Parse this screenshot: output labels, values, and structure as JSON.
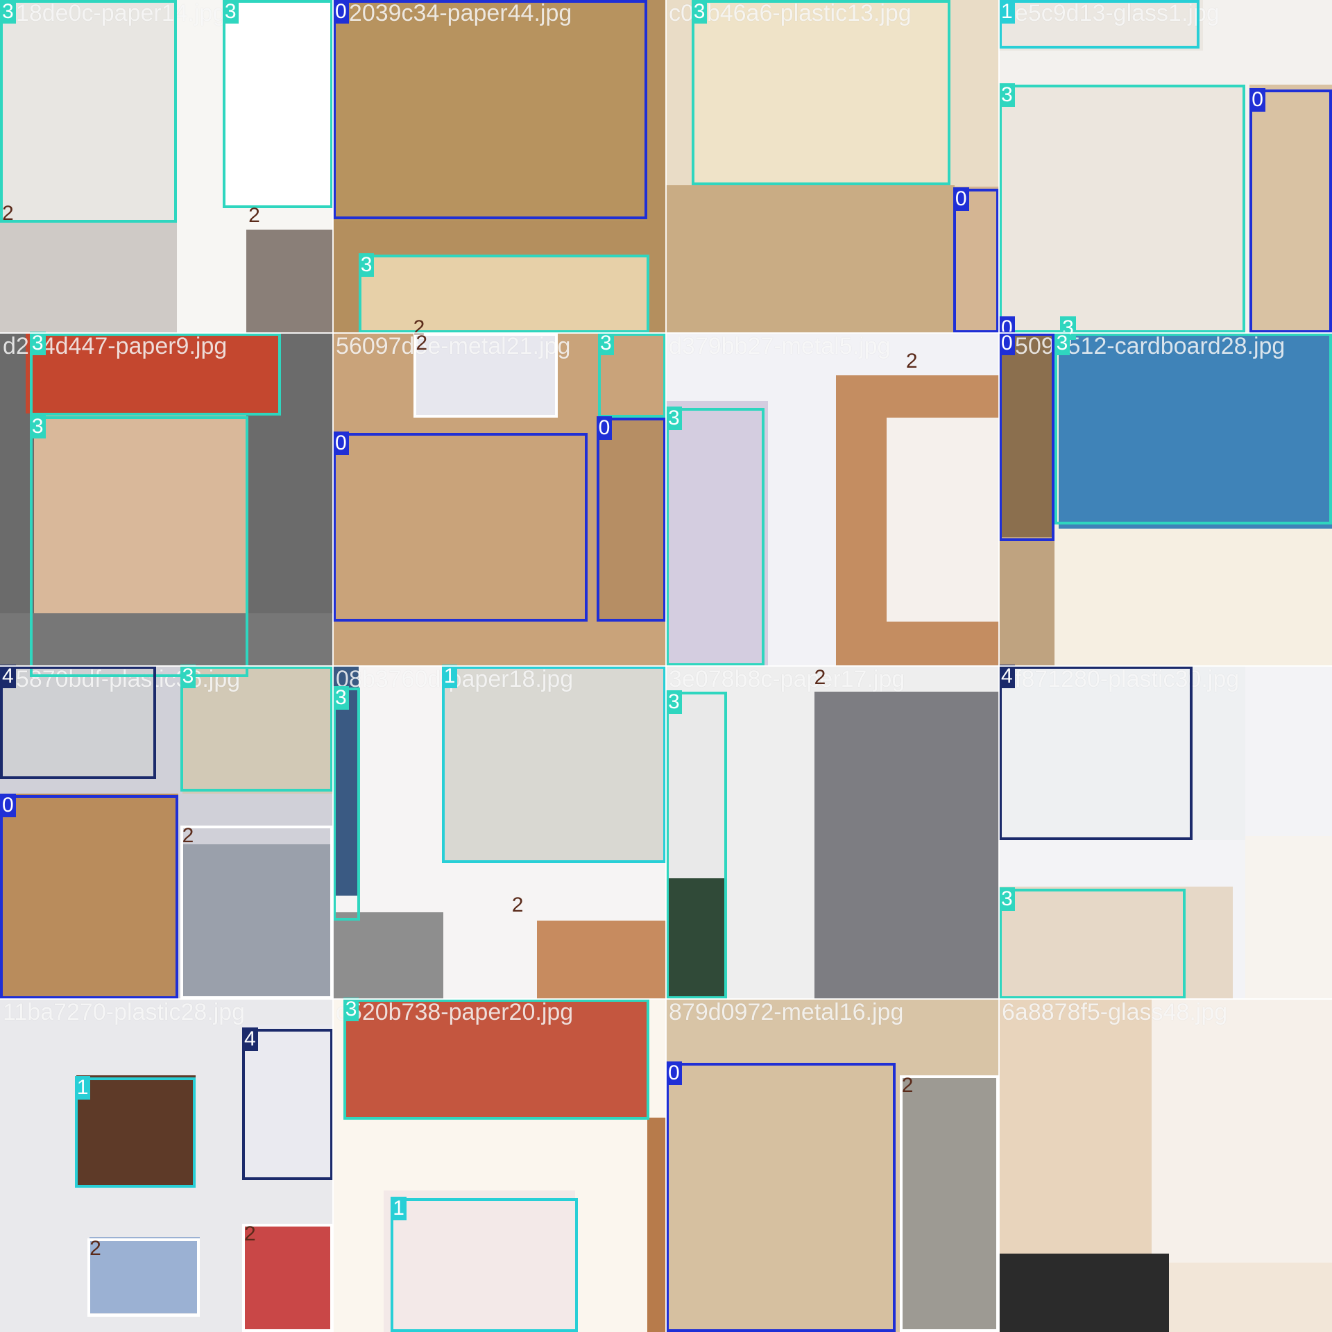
{
  "class_colors": {
    "0": "#1f2fd6",
    "1": "#28cfd6",
    "2": "#ffffff",
    "3": "#2fd6bf",
    "4": "#1b2a6b"
  },
  "label_text_colors": {
    "0": "#ffffff",
    "1": "#ffffff",
    "2": "#5a2a1a",
    "3": "#ffffff",
    "4": "#ffffff"
  },
  "tiles": [
    {
      "filename": "318de0c-paper14.jpg",
      "bg": "#f7f6f3"
    },
    {
      "filename": "12039c34-paper44.jpg",
      "bg": "#b48f5e"
    },
    {
      "filename": "c03b46a6-plastic13.jpg",
      "bg": "#e9dcc6"
    },
    {
      "filename": "1e5c9d13-glass1.jpg",
      "bg": "#f3f1ee"
    },
    {
      "filename": "d2d4d447-paper9.jpg",
      "bg": "#6b6b6b"
    },
    {
      "filename": "56097d5e-metal21.jpg",
      "bg": "#c9a37a"
    },
    {
      "filename": "d379bb27-metal5.jpg",
      "bg": "#f2f2f6"
    },
    {
      "filename": "a5092512-cardboard28.jpg",
      "bg": "#f6efe2"
    },
    {
      "filename": "05870bdf-plastic36.jpg",
      "bg": "#d0d0d8"
    },
    {
      "filename": "08b3760d-paper18.jpg",
      "bg": "#f6f4f4"
    },
    {
      "filename": "3e078b8c-paper17.jpg",
      "bg": "#eeeeee"
    },
    {
      "filename": "3f871280-plastic30.jpg",
      "bg": "#f3f3f6"
    },
    {
      "filename": "11ba7270-plastic28.jpg",
      "bg": "#e9e9ec"
    },
    {
      "filename": "d520b738-paper20.jpg",
      "bg": "#fbf6ee"
    },
    {
      "filename": "879d0972-metal16.jpg",
      "bg": "#d8c4a6"
    },
    {
      "filename": "6a8878f5-glass48.jpg",
      "bg": "#f2e6d8"
    }
  ],
  "boxes": [
    {
      "cls": "3"
    },
    {
      "cls": "3"
    },
    {
      "cls": "2"
    },
    {
      "cls": "2"
    },
    {
      "cls": "0"
    },
    {
      "cls": "3"
    },
    {
      "cls": "2"
    },
    {
      "cls": "3"
    },
    {
      "cls": "0"
    },
    {
      "cls": "1"
    },
    {
      "cls": "3"
    },
    {
      "cls": "0"
    },
    {
      "cls": "0"
    },
    {
      "cls": "3"
    },
    {
      "cls": "3"
    },
    {
      "cls": "3"
    },
    {
      "cls": "0"
    },
    {
      "cls": "0"
    },
    {
      "cls": "3"
    },
    {
      "cls": "2"
    },
    {
      "cls": "3"
    },
    {
      "cls": "2"
    },
    {
      "cls": "0"
    },
    {
      "cls": "3"
    },
    {
      "cls": "4"
    },
    {
      "cls": "3"
    },
    {
      "cls": "0"
    },
    {
      "cls": "2"
    },
    {
      "cls": "3"
    },
    {
      "cls": "1"
    },
    {
      "cls": "2"
    },
    {
      "cls": "3"
    },
    {
      "cls": "2"
    },
    {
      "cls": "4"
    },
    {
      "cls": "3"
    },
    {
      "cls": "1"
    },
    {
      "cls": "4"
    },
    {
      "cls": "2"
    },
    {
      "cls": "2"
    },
    {
      "cls": "3"
    },
    {
      "cls": "1"
    },
    {
      "cls": "0"
    },
    {
      "cls": "2"
    }
  ]
}
